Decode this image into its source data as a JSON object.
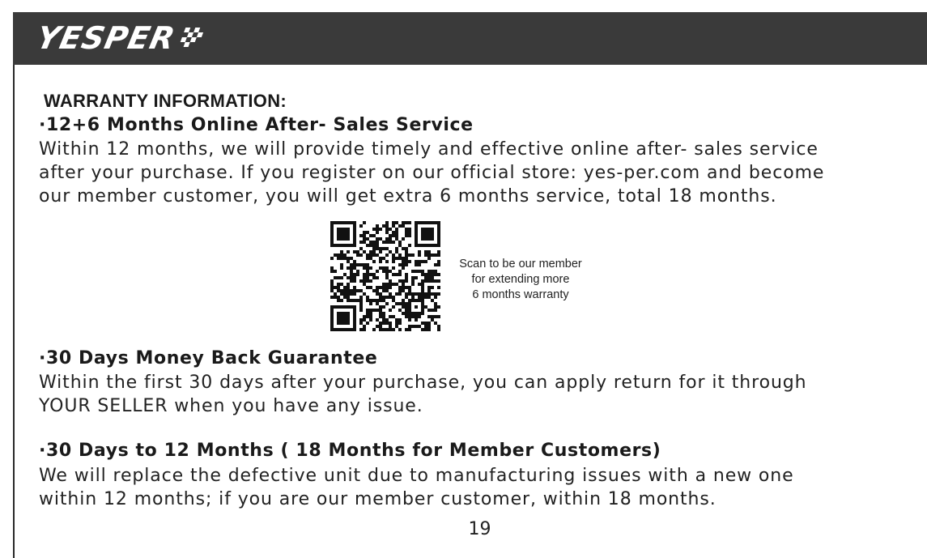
{
  "header": {
    "logo_text": "YESPER"
  },
  "warranty": {
    "title": "WARRANTY INFORMATION:",
    "sections": [
      {
        "heading": "·12+6 Months Online After- Sales Service",
        "lines": [
          "Within 12 months, we will provide timely and effective online after- sales service",
          "after your purchase. If you register on our official store: yes-per.com and become",
          "our member customer, you will get extra 6 months service, total 18 months."
        ]
      },
      {
        "heading": "·30 Days Money Back Guarantee",
        "lines": [
          "Within the first 30 days after your purchase, you can apply return for it through",
          "YOUR SELLER when you have any issue."
        ]
      },
      {
        "heading": "·30 Days to 12 Months ( 18 Months for Member Customers)",
        "lines": [
          "We will replace the defective unit due to manufacturing issues with a new one",
          "within 12 months; if you are our member customer, within 18 months."
        ]
      }
    ]
  },
  "qr": {
    "caption_lines": [
      "Scan to be our member",
      "for extending more",
      "6 months warranty"
    ]
  },
  "page_number": "19"
}
